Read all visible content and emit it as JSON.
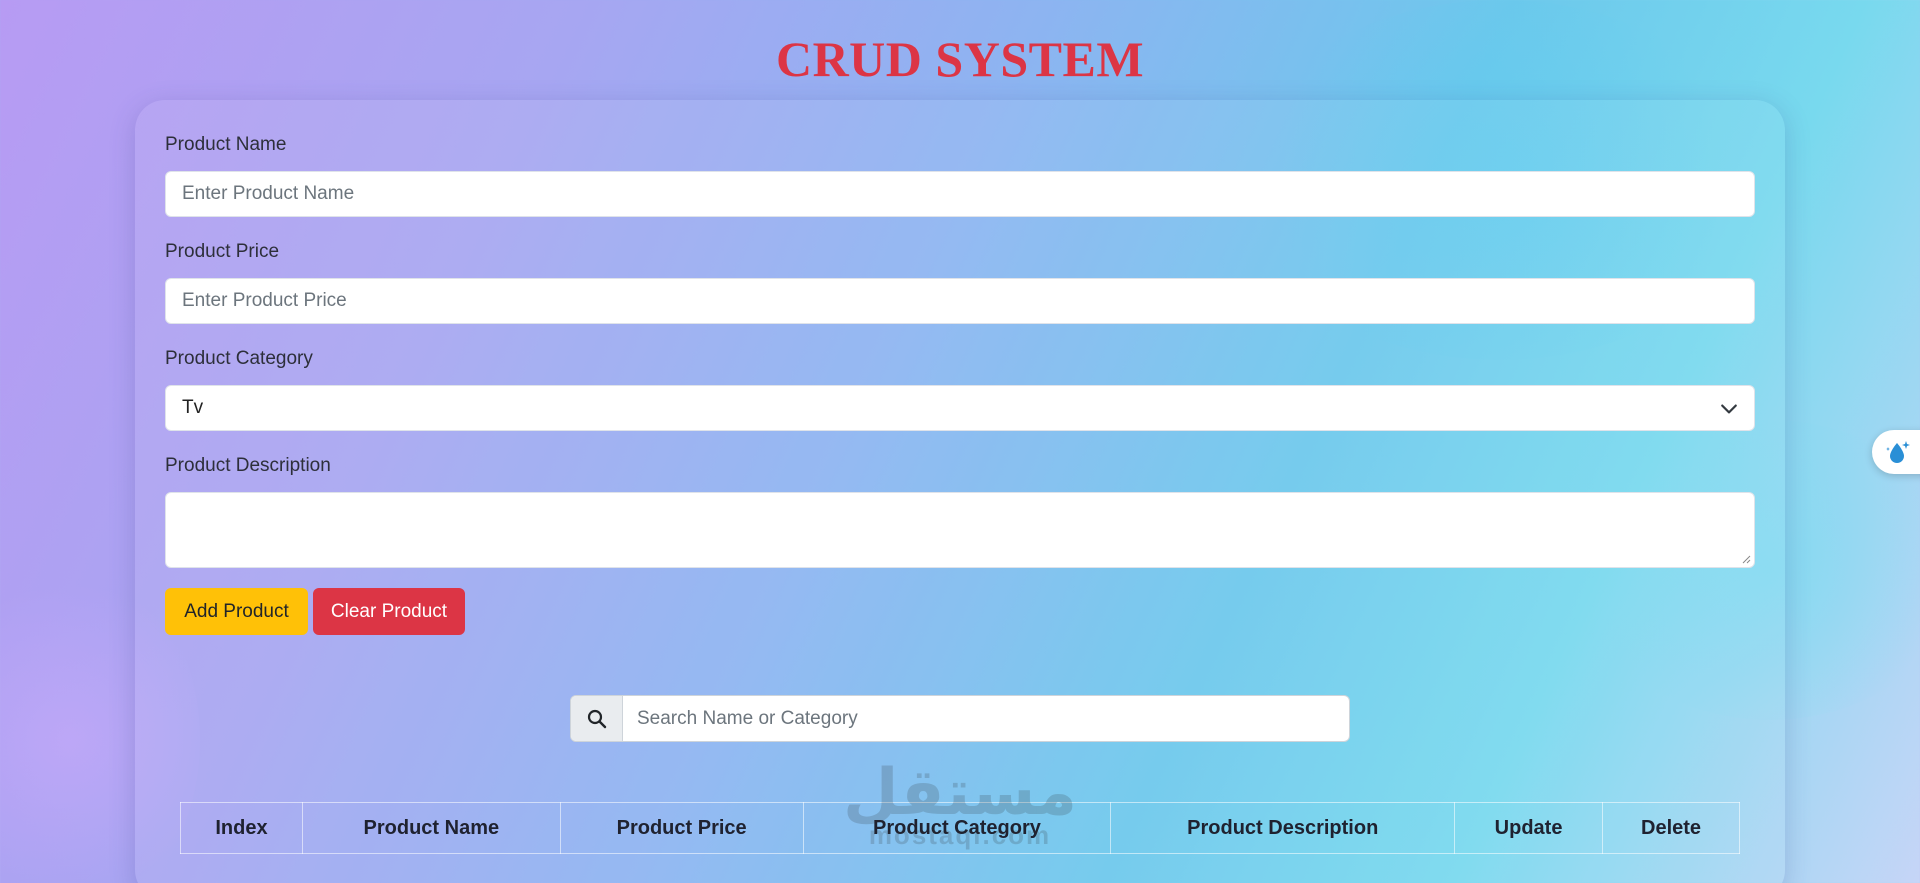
{
  "header": {
    "title": "CRUD SYSTEM"
  },
  "form": {
    "name": {
      "label": "Product Name",
      "placeholder": "Enter Product Name"
    },
    "price": {
      "label": "Product Price",
      "placeholder": "Enter Product Price"
    },
    "category": {
      "label": "Product Category",
      "selected": "Tv"
    },
    "description": {
      "label": "Product Description",
      "placeholder": ""
    },
    "add_label": "Add Product",
    "clear_label": "Clear Product"
  },
  "search": {
    "placeholder": "Search Name or Category",
    "icon": "search-icon"
  },
  "table": {
    "headers": [
      "Index",
      "Product Name",
      "Product Price",
      "Product Category",
      "Product Description",
      "Update",
      "Delete"
    ]
  },
  "watermark": {
    "arabic": "مستقل",
    "latin": "mostaql.com"
  },
  "colors": {
    "title": "#dc3545",
    "add_button": "#ffc107",
    "clear_button": "#dc3545"
  }
}
